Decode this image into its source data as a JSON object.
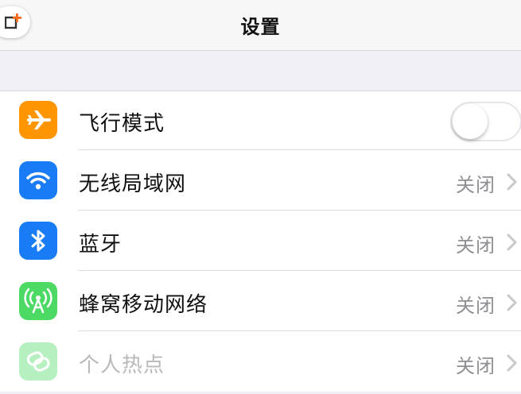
{
  "header": {
    "title": "设置"
  },
  "colors": {
    "airplane": "#ff9500",
    "wifi": "#1a7cf5",
    "bluetooth": "#1a7cf5",
    "cellular": "#4cd964",
    "hotspot": "#4cd964",
    "overlay_accent": "#ff6a1a"
  },
  "settings": {
    "items": [
      {
        "label": "飞行模式",
        "icon": "airplane-icon",
        "control": "toggle",
        "toggle_on": false
      },
      {
        "label": "无线局域网",
        "icon": "wifi-icon",
        "value": "关闭"
      },
      {
        "label": "蓝牙",
        "icon": "bluetooth-icon",
        "value": "关闭"
      },
      {
        "label": "蜂窝移动网络",
        "icon": "cellular-antenna-icon",
        "value": "关闭"
      },
      {
        "label": "个人热点",
        "icon": "hotspot-link-icon",
        "value": "关闭",
        "dimmed": true
      }
    ]
  }
}
